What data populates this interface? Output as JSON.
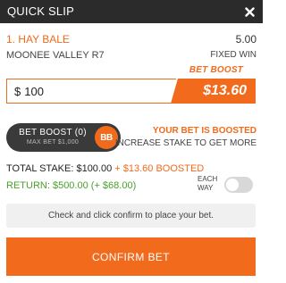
{
  "header": {
    "title": "QUICK SLIP",
    "close_icon": "close-icon"
  },
  "selection": {
    "name": "1. HAY BALE",
    "odds": "5.00",
    "race": "MOONEE VALLEY R7",
    "market": "FIXED WIN"
  },
  "stake": {
    "currency": "$",
    "value": "100",
    "boost_tag": "BET BOOST",
    "boost_amount": "$13.60"
  },
  "boost_toggle": {
    "label": "BET BOOST (0)",
    "max_bet": "MAX BET $1,000",
    "icon_text": "BB",
    "boosted_message": "YOUR BET IS BOOSTED",
    "increase_message": "INCREASE STAKE TO GET MORE"
  },
  "totals": {
    "stake_label": "TOTAL STAKE:",
    "stake_value": "$100.00",
    "stake_boost": "+ $13.60 BOOSTED",
    "return_label": "RETURN:",
    "return_value": "$500.00",
    "return_boost": "(+ $68.00)"
  },
  "each_way": {
    "line1": "EACH",
    "line2": "WAY",
    "enabled": false
  },
  "info": {
    "message": "Check and click confirm to place your bet."
  },
  "actions": {
    "confirm_label": "CONFIRM BET"
  },
  "colors": {
    "accent": "#f26a1b",
    "header_bg": "#2b2b2b",
    "return_green": "#4aa02c"
  }
}
